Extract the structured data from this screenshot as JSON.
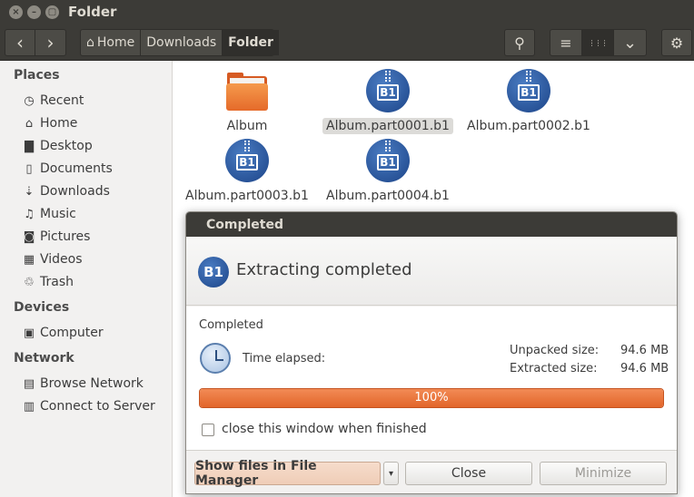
{
  "window": {
    "title": "Folder",
    "controls": {
      "close": "×",
      "minimize": "–",
      "maximize": "▢"
    }
  },
  "toolbar": {
    "back_icon": "‹",
    "forward_icon": "›",
    "breadcrumbs": [
      {
        "icon": "⌂",
        "label": "Home"
      },
      {
        "label": "Downloads"
      },
      {
        "label": "Folder",
        "active": true
      }
    ],
    "search_icon": "⚲",
    "list_view_icon": "≡",
    "grid_view_icon": "⋮⋮⋮",
    "dropdown_icon": "⌄",
    "settings_icon": "⚙"
  },
  "sidebar": {
    "sections": [
      {
        "heading": "Places",
        "items": [
          {
            "icon": "◷",
            "label": "Recent"
          },
          {
            "icon": "⌂",
            "label": "Home"
          },
          {
            "icon": "▇",
            "label": "Desktop"
          },
          {
            "icon": "▯",
            "label": "Documents"
          },
          {
            "icon": "⇣",
            "label": "Downloads"
          },
          {
            "icon": "♫",
            "label": "Music"
          },
          {
            "icon": "◙",
            "label": "Pictures"
          },
          {
            "icon": "▦",
            "label": "Videos"
          },
          {
            "icon": "♲",
            "label": "Trash"
          }
        ]
      },
      {
        "heading": "Devices",
        "items": [
          {
            "icon": "▣",
            "label": "Computer"
          }
        ]
      },
      {
        "heading": "Network",
        "items": [
          {
            "icon": "▤",
            "label": "Browse Network"
          },
          {
            "icon": "▥",
            "label": "Connect to Server"
          }
        ]
      }
    ]
  },
  "files": [
    {
      "name": "Album",
      "type": "folder"
    },
    {
      "name": "Album.part0001.b1",
      "type": "b1",
      "selected": true
    },
    {
      "name": "Album.part0002.b1",
      "type": "b1"
    },
    {
      "name": "Album.part0003.b1",
      "type": "b1"
    },
    {
      "name": "Album.part0004.b1",
      "type": "b1"
    }
  ],
  "b1_icon_text": "B1",
  "dialog": {
    "title": "Completed",
    "heading": "Extracting completed",
    "status": "Completed",
    "time_elapsed_label": "Time elapsed:",
    "unpacked_label": "Unpacked size:",
    "unpacked_value": "94.6 MB",
    "extracted_label": "Extracted size:",
    "extracted_value": "94.6 MB",
    "progress_percent": 100,
    "progress_text": "100%",
    "checkbox_label": "close this window when finished",
    "checkbox_checked": false,
    "buttons": {
      "show_files": "Show files in File Manager",
      "dropdown": "▾",
      "close": "Close",
      "minimize": "Minimize"
    }
  },
  "colors": {
    "progress_fill": "#e2652a",
    "titlebar": "#3c3b37",
    "b1_icon": "#1c4488"
  }
}
